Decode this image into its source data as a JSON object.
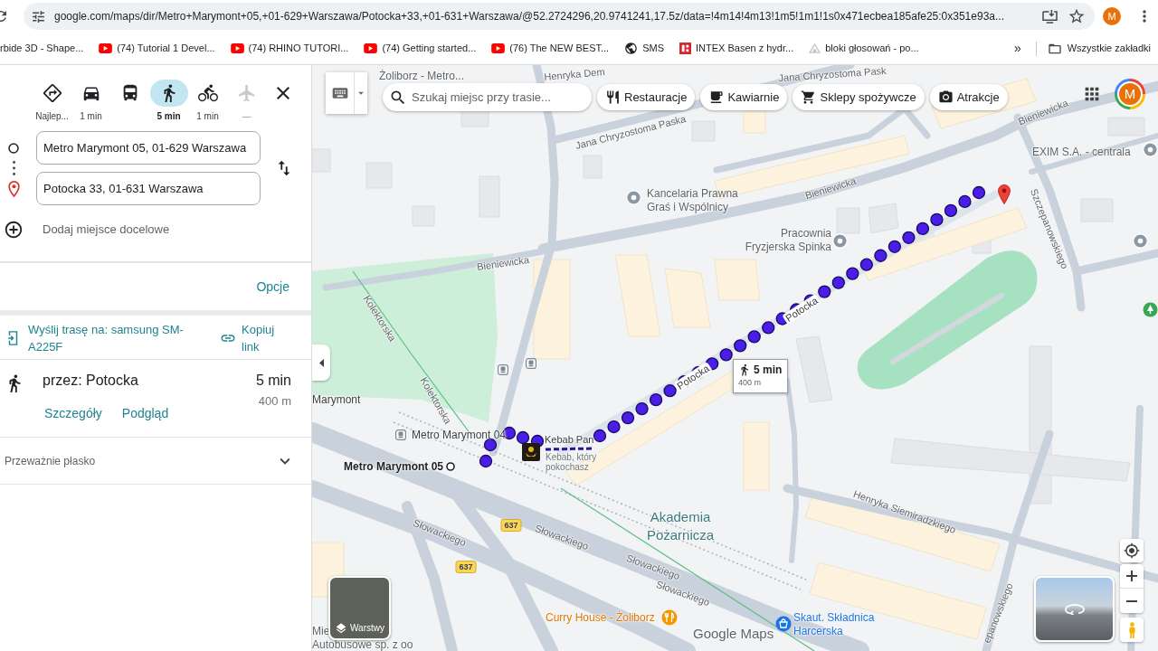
{
  "browser": {
    "url": "google.com/maps/dir/Metro+Marymont+05,+01-629+Warszawa/Potocka+33,+01-631+Warszawa/@52.2724296,20.9741241,17.5z/data=!4m14!4m13!1m5!1m1!1s0x471ecbea185afe25:0x351e93a...",
    "profile_initial": "M",
    "bookmarks": [
      {
        "kind": "none",
        "label": "rbide 3D - Shape..."
      },
      {
        "kind": "video",
        "label": "(74) Tutorial 1 Devel..."
      },
      {
        "kind": "video",
        "label": "(74) RHINO TUTORI..."
      },
      {
        "kind": "video",
        "label": "(74) Getting started..."
      },
      {
        "kind": "video",
        "label": "(76) The NEW BEST..."
      },
      {
        "kind": "globe",
        "label": "SMS"
      },
      {
        "kind": "tile",
        "label": "INTEX Basen z hydr..."
      },
      {
        "kind": "faint",
        "label": "bloki głosowań - po..."
      }
    ],
    "more_bookmarks": "»",
    "all_bookmarks": "Wszystkie zakładki"
  },
  "directions_panel": {
    "travel_modes": [
      {
        "kind": "best",
        "label": "Najlep...",
        "selected": false,
        "disabled": false
      },
      {
        "kind": "car",
        "label": "1 min",
        "selected": false,
        "disabled": false
      },
      {
        "kind": "transit",
        "selected": false,
        "disabled": false
      },
      {
        "kind": "walk",
        "label": "5 min",
        "selected": true,
        "disabled": false
      },
      {
        "kind": "bike",
        "label": "1 min",
        "selected": false,
        "disabled": false
      },
      {
        "kind": "flight",
        "label": "—",
        "selected": false,
        "disabled": true
      }
    ],
    "origin": {
      "value": "Metro Marymont 05, 01-629 Warszawa"
    },
    "destination": {
      "value": "Potocka 33, 01-631 Warszawa"
    },
    "add_destination": "Dodaj miejsce docelowe",
    "options_link": "Opcje",
    "send_route": "Wyślij trasę na: samsung SM-A225F",
    "copy_link": "Kopiuj link",
    "route": {
      "via": "przez: Potocka",
      "duration": "5 min",
      "distance": "400 m",
      "details_link": "Szczegóły",
      "preview_link": "Podgląd"
    },
    "elevation": {
      "summary": "Przeważnie płasko",
      "expanded": false
    }
  },
  "map": {
    "search": {
      "placeholder": "Szukaj miejsc przy trasie..."
    },
    "chips": [
      {
        "kind": "restaurants",
        "label": "Restauracje"
      },
      {
        "kind": "cafes",
        "label": "Kawiarnie"
      },
      {
        "kind": "groceries",
        "label": "Sklepy spożywcze"
      },
      {
        "kind": "attractions",
        "label": "Atrakcje"
      }
    ],
    "account_initial": "M",
    "labels": [
      {
        "kind": "place",
        "text": "Żoliborz - Metro..."
      },
      {
        "kind": "street",
        "text": "Henryka Dem"
      },
      {
        "kind": "street",
        "text": "Jana Chryzostoma Pask"
      },
      {
        "kind": "street",
        "text": "Jana Chryzostoma Paska"
      },
      {
        "kind": "street",
        "text": "Bieniewicka"
      },
      {
        "kind": "place",
        "text": "EXIM S.A. - centrala"
      },
      {
        "kind": "place",
        "text": "Kancelaria Prawna Graś i Wspólnicy"
      },
      {
        "kind": "street",
        "text": "Bieniewicka"
      },
      {
        "kind": "place",
        "text": "Pracownia Fryzjerska Spinka"
      },
      {
        "kind": "street",
        "text": "Bieniewicka"
      },
      {
        "kind": "street",
        "text": "Szczepanowskiego"
      },
      {
        "kind": "street",
        "text": "Kolektorska"
      },
      {
        "kind": "route-street",
        "text": "Potocka"
      },
      {
        "kind": "route-street",
        "text": "Potocka"
      },
      {
        "kind": "transit",
        "text": "Marymont"
      },
      {
        "kind": "street",
        "text": "Kolektorska"
      },
      {
        "kind": "transit",
        "text": "Metro Marymont 04"
      },
      {
        "kind": "poi",
        "text": "Kebab Pan"
      },
      {
        "kind": "origin",
        "text": "Metro Marymont 05"
      },
      {
        "kind": "poi-note",
        "text": "Kebab, który pokochasz"
      },
      {
        "kind": "street",
        "text": "Słowackiego"
      },
      {
        "kind": "road-number",
        "text": "637"
      },
      {
        "kind": "street",
        "text": "Słowackiego"
      },
      {
        "kind": "area",
        "text": "Akademia Pożarnicza"
      },
      {
        "kind": "street",
        "text": "Henryka Siemiradzkiego"
      },
      {
        "kind": "road-number",
        "text": "637"
      },
      {
        "kind": "street",
        "text": "Słowackiego"
      },
      {
        "kind": "street",
        "text": "Słowackiego"
      },
      {
        "kind": "restaurant",
        "text": "Curry House - Żoliborz"
      },
      {
        "kind": "place",
        "text": "Mie"
      },
      {
        "kind": "shop",
        "text": "Skaut. Składnica Harcerska"
      },
      {
        "kind": "place",
        "text": "Autobusowe sp. z oo"
      },
      {
        "kind": "street",
        "text": "epanowskiego"
      }
    ],
    "route_callout": {
      "duration": "5 min",
      "distance": "400 m"
    },
    "layers_button": "Warstwy",
    "logo": "Google Maps"
  }
}
